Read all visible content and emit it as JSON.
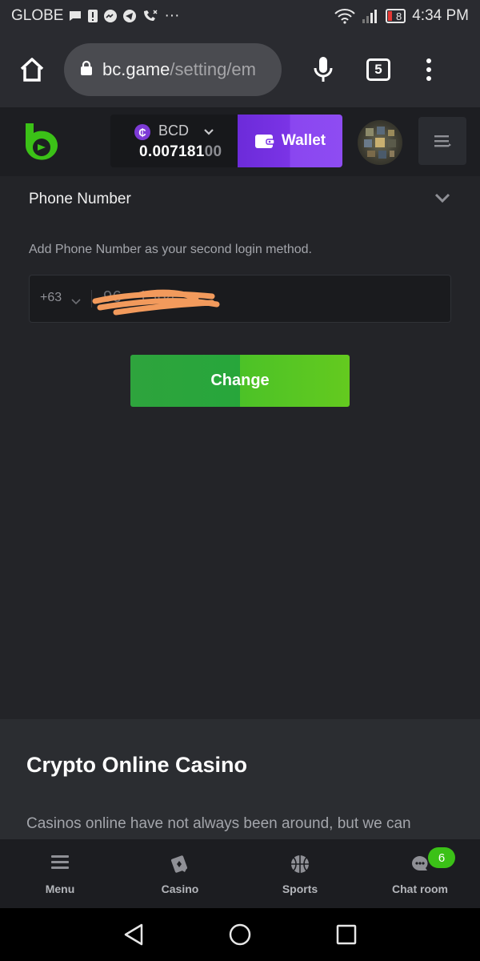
{
  "status_bar": {
    "carrier": "GLOBE",
    "battery": "8",
    "time": "4:34 PM",
    "overflow": "···"
  },
  "browser": {
    "url_host": "bc.game",
    "url_path": "/setting/em",
    "tab_count": "5"
  },
  "header": {
    "currency": "BCD",
    "balance_main": "0.007181",
    "balance_dim": "00",
    "wallet_label": "Wallet"
  },
  "content": {
    "section_title": "Phone Number",
    "description": "Add Phone Number as your second login method.",
    "country_code": "+63",
    "phone_visible": "96  1564",
    "change_label": "Change"
  },
  "footer_info": {
    "title": "Crypto Online Casino",
    "text": "Casinos online have not always been around, but we can"
  },
  "bottom_nav": {
    "items": [
      {
        "label": "Menu",
        "icon": "menu-icon"
      },
      {
        "label": "Casino",
        "icon": "casino-icon"
      },
      {
        "label": "Sports",
        "icon": "sports-icon"
      },
      {
        "label": "Chat room",
        "icon": "chat-icon"
      }
    ],
    "chat_badge": "6"
  },
  "colors": {
    "wallet": "#7b34e6",
    "change": "#3bb22e",
    "badge": "#3bc117",
    "logo": "#3bc117"
  }
}
